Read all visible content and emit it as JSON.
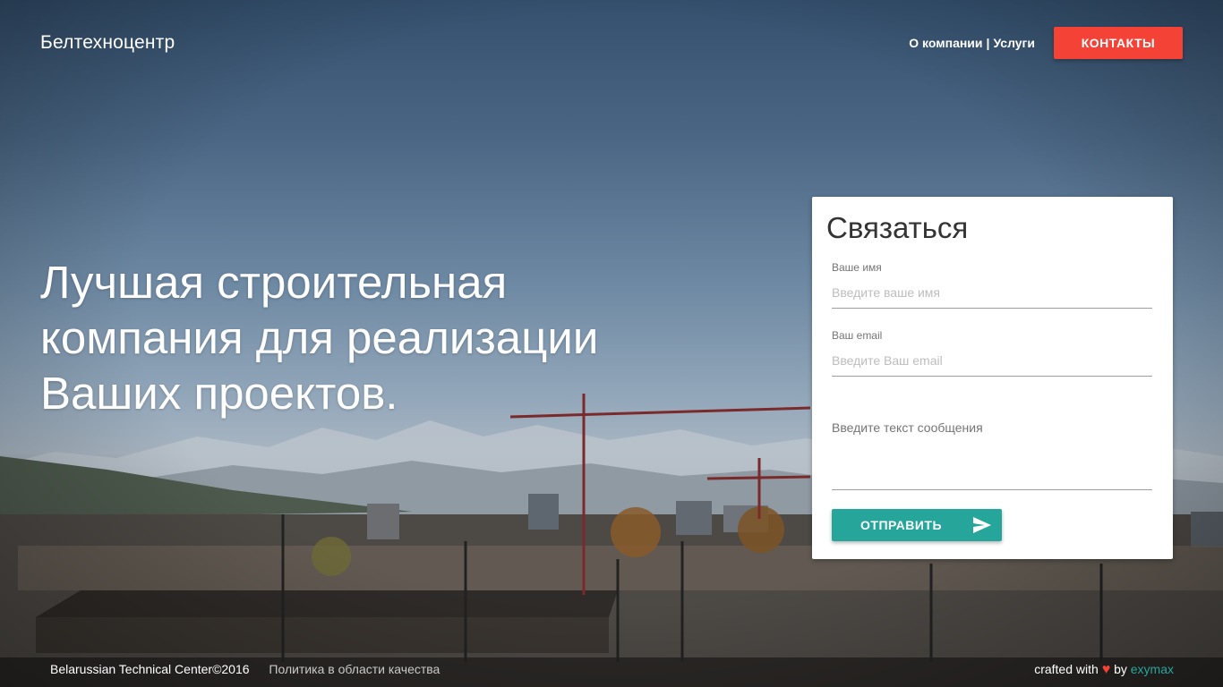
{
  "header": {
    "brand": "Белтехноцентр",
    "nav": {
      "about": "О компании",
      "separator": "|",
      "services": "Услуги"
    },
    "contact_button": "КОНТАКТЫ"
  },
  "hero": {
    "headline": "Лучшая строительная компания для реализации Ваших проектов."
  },
  "form": {
    "title": "Связаться",
    "name_label": "Ваше имя",
    "name_placeholder": "Введите ваше имя",
    "email_label": "Ваш email",
    "email_placeholder": "Введите Ваш email",
    "message_placeholder": "Введите текст сообщения",
    "submit_label": "ОТПРАВИТЬ"
  },
  "footer": {
    "copyright": "Belarussian Technical Center©2016",
    "policy_link": "Политика в области качества",
    "crafted_prefix": "crafted with",
    "crafted_by": "by",
    "crafted_brand": "exymax"
  },
  "colors": {
    "accent_red": "#f44336",
    "accent_teal": "#26a69a"
  },
  "icons": {
    "heart": "heart-icon",
    "send": "send-icon"
  }
}
